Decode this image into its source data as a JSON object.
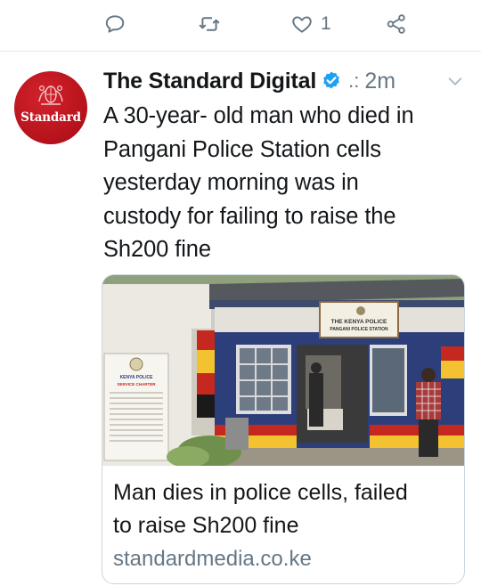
{
  "actions": {
    "reply_icon": "speech-bubble-icon",
    "retweet_icon": "retweet-icon",
    "like_icon": "heart-icon",
    "like_count": "1",
    "share_icon": "share-icon"
  },
  "tweet": {
    "avatar_logo_text": "Standard",
    "display_name": "The Standard Digital",
    "verified": true,
    "separator": ".:",
    "timestamp": "2m",
    "text_lines": [
      "A 30-year- old man who died in",
      "Pangani Police Station cells",
      "yesterday morning was in",
      "custody for failing to raise the",
      "Sh200 fine"
    ]
  },
  "card": {
    "image_sign_line1": "THE KENYA POLICE",
    "image_sign_line2": "PANGANI POLICE STATION",
    "image_board_line1": "KENYA POLICE",
    "image_board_line2": "SERVICE CHARTER",
    "title_lines": [
      "Man dies in police cells, failed",
      "to raise Sh200 fine"
    ],
    "domain": "standardmedia.co.ke"
  },
  "colors": {
    "accent_blue": "#1da1f2",
    "muted_gray": "#657786",
    "brand_red": "#c4161c"
  }
}
